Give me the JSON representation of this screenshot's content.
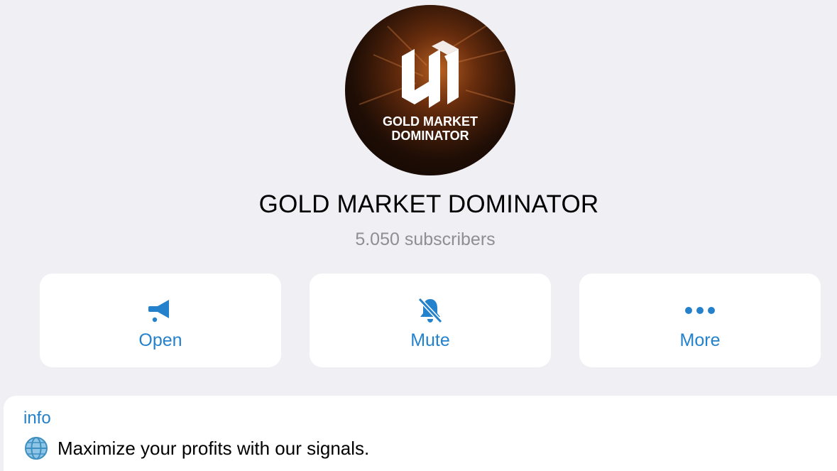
{
  "channel": {
    "logo_text_line1": "GOLD MARKET",
    "logo_text_line2": "DOMINATOR",
    "title": "GOLD MARKET DOMINATOR",
    "subscribers": "5.050 subscribers"
  },
  "actions": [
    {
      "label": "Open",
      "icon": "megaphone-icon"
    },
    {
      "label": "Mute",
      "icon": "bell-slash-icon"
    },
    {
      "label": "More",
      "icon": "ellipsis-icon"
    }
  ],
  "info": {
    "label": "info",
    "icon": "globe-icon",
    "text": "Maximize your profits with our signals."
  },
  "colors": {
    "background": "#efeff4",
    "accent": "#2481cc",
    "card": "#ffffff",
    "secondary_text": "#8e8e93"
  }
}
